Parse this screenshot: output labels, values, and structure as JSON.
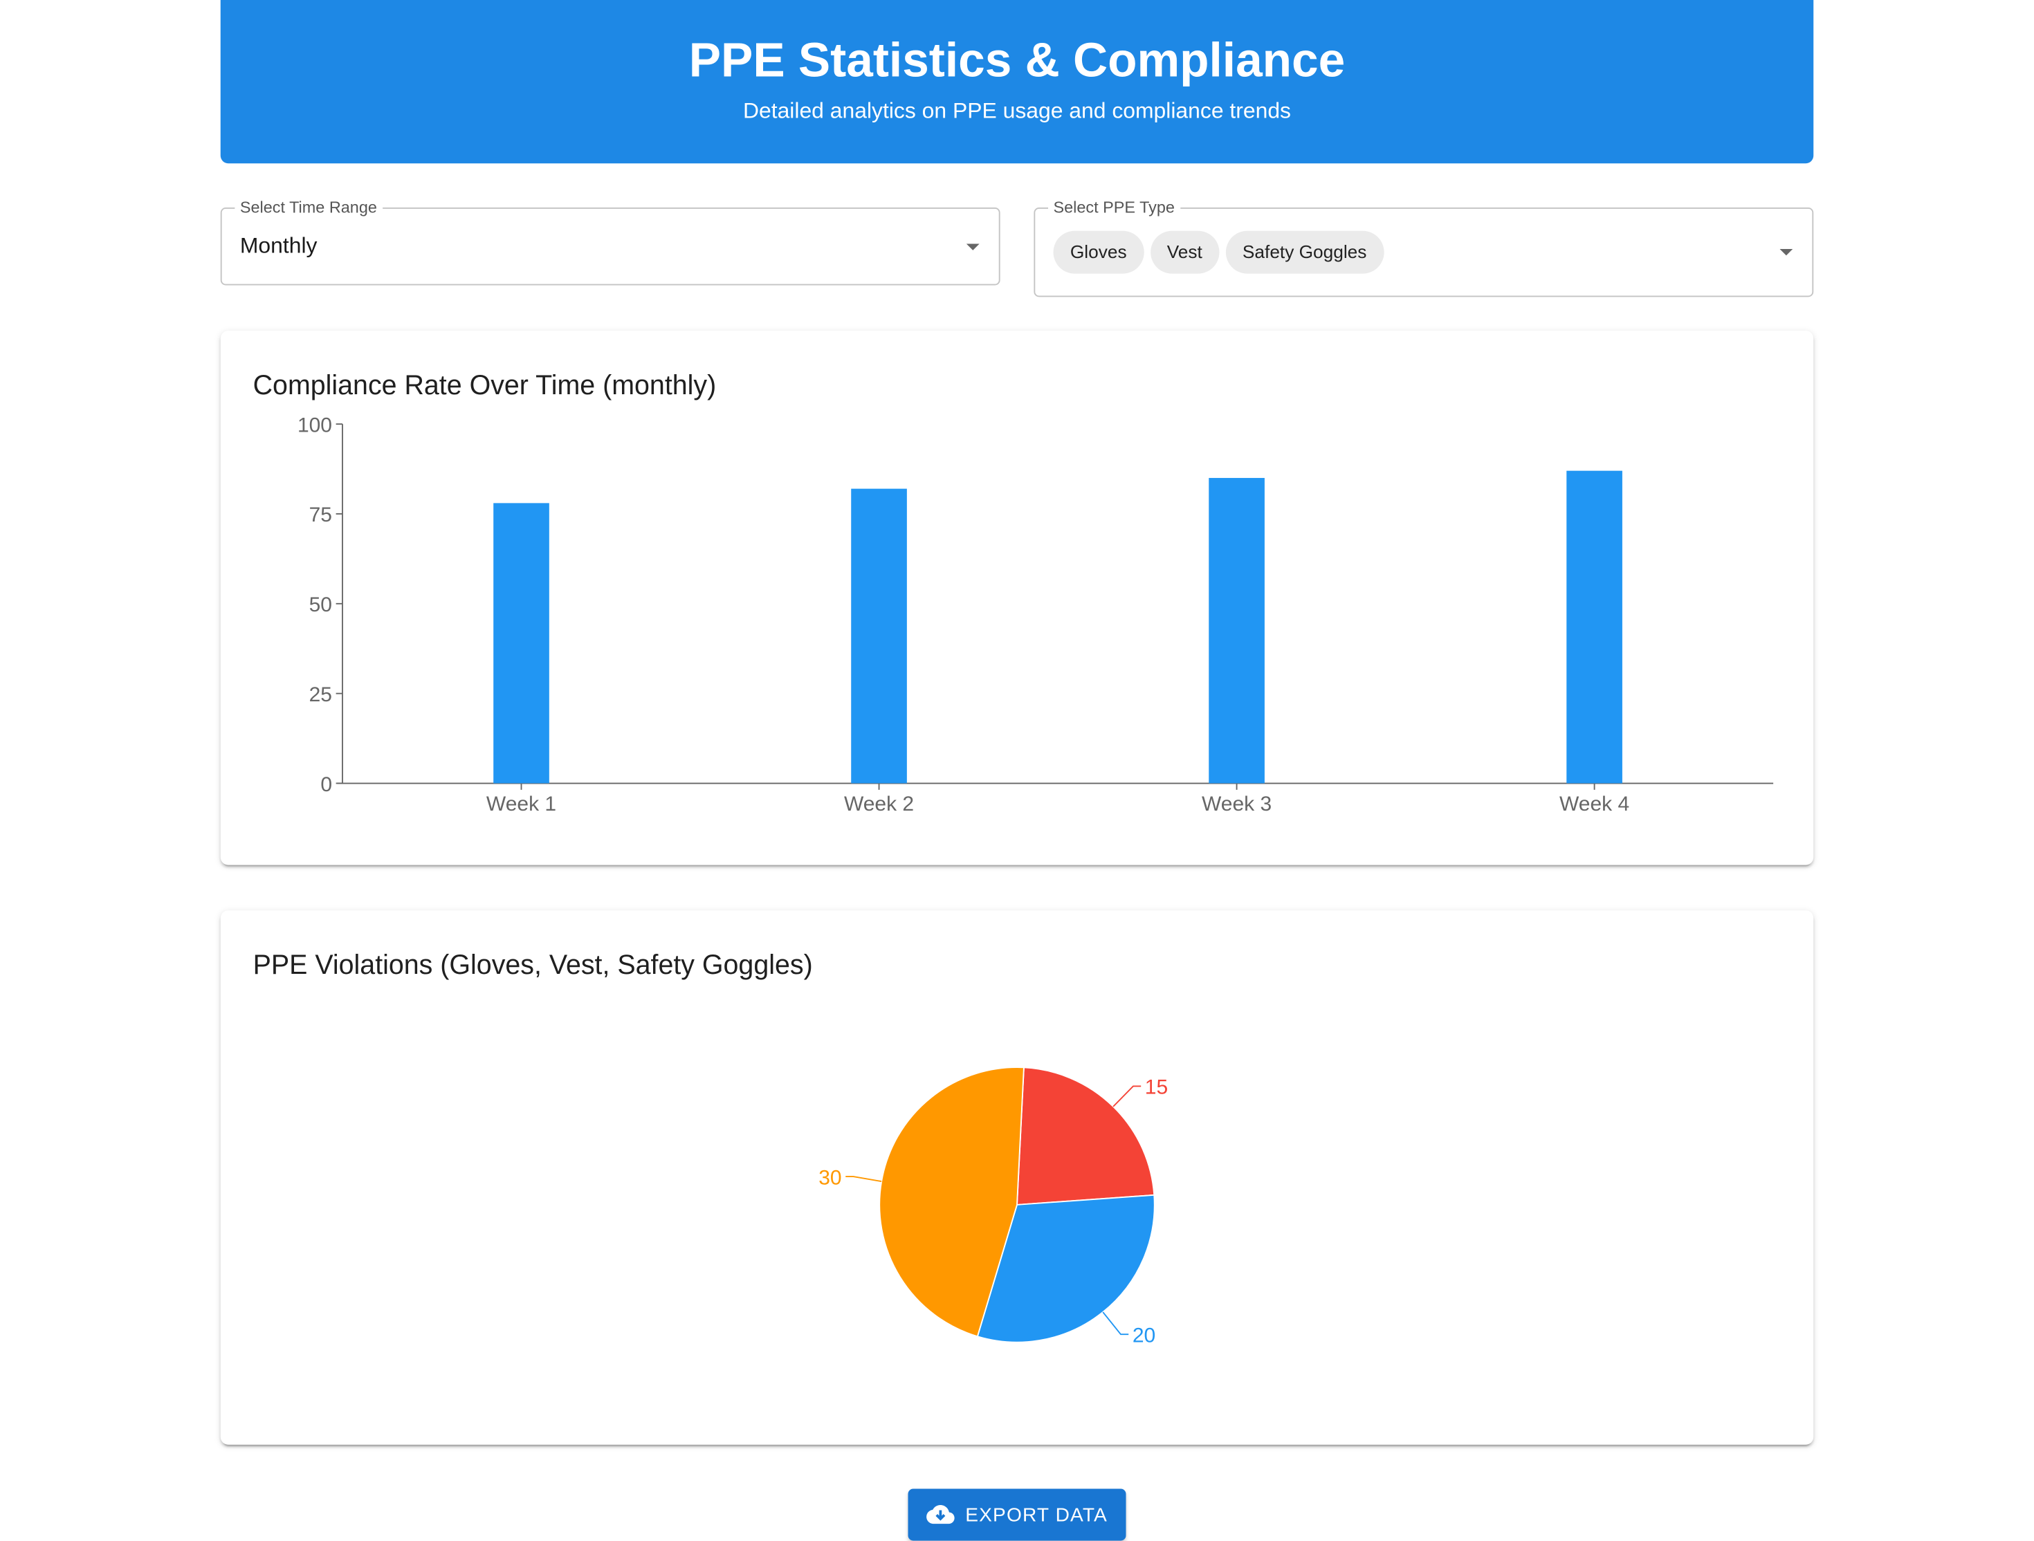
{
  "header": {
    "title": "PPE Statistics & Compliance",
    "subtitle": "Detailed analytics on PPE usage and compliance trends"
  },
  "filters": {
    "time_range": {
      "label": "Select Time Range",
      "value": "Monthly"
    },
    "ppe_type": {
      "label": "Select PPE Type",
      "chips": [
        "Gloves",
        "Vest",
        "Safety Goggles"
      ]
    }
  },
  "compliance_card": {
    "title": "Compliance Rate Over Time (monthly)"
  },
  "violations_card": {
    "title": "PPE Violations (Gloves, Vest, Safety Goggles)"
  },
  "export_button": {
    "label": "EXPORT DATA",
    "icon": "cloud-download-icon"
  },
  "colors": {
    "primary": "#1e88e5",
    "bar": "#2196f3",
    "button": "#1976d2",
    "violation_gloves": "#f44336",
    "violation_vest": "#2196f3",
    "violation_goggles": "#ff9800"
  },
  "chart_data": [
    {
      "type": "bar",
      "title": "Compliance Rate Over Time (monthly)",
      "categories": [
        "Week 1",
        "Week 2",
        "Week 3",
        "Week 4"
      ],
      "values": [
        78,
        82,
        85,
        87
      ],
      "yticks": [
        "0",
        "25",
        "50",
        "75",
        "100"
      ],
      "ylim": [
        0,
        100
      ],
      "grid": false,
      "color": "#2196f3"
    },
    {
      "type": "pie",
      "title": "PPE Violations (Gloves, Vest, Safety Goggles)",
      "values": [
        15,
        20,
        30
      ],
      "labels": [
        "15",
        "20",
        "30"
      ],
      "colors": [
        "#f44336",
        "#2196f3",
        "#ff9800"
      ]
    }
  ]
}
